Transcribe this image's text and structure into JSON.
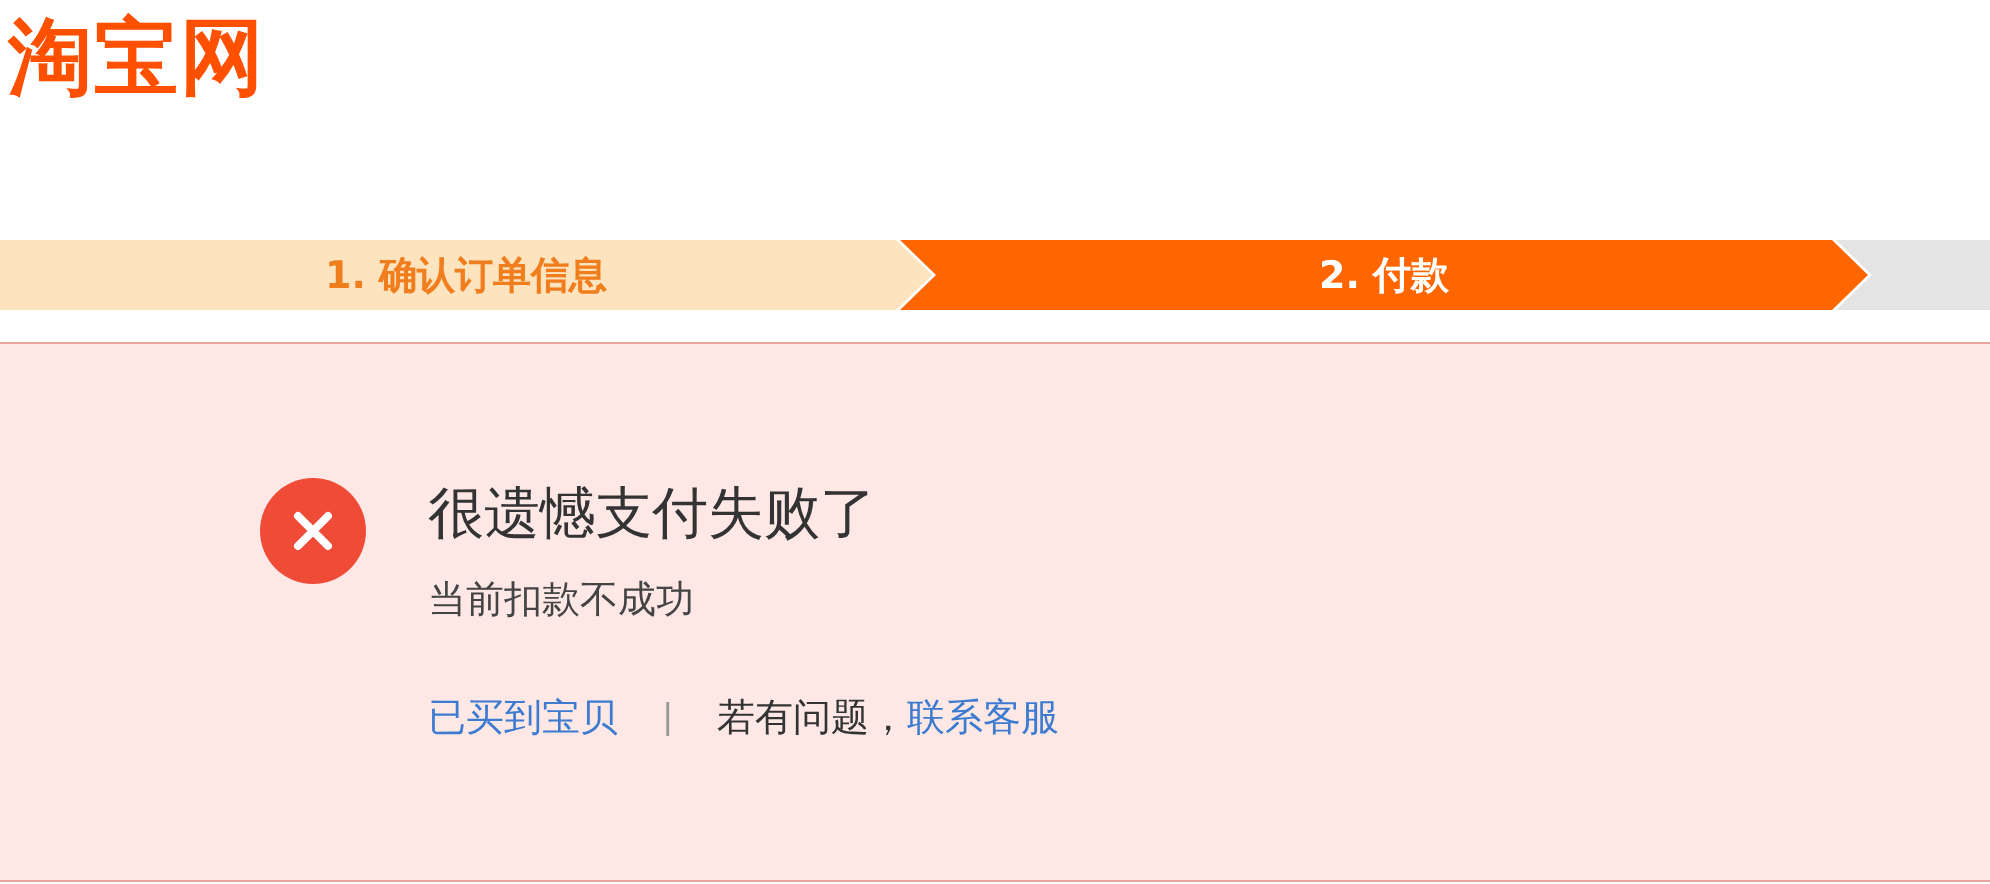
{
  "logo": "淘宝网",
  "steps": [
    {
      "label": "1. 确认订单信息",
      "selected": false
    },
    {
      "label": "2. 付款",
      "selected": true
    },
    {
      "selected": false
    }
  ],
  "result": {
    "kind": "error",
    "title": "很遗憾支付失败了",
    "message": "当前扣款不成功",
    "links": [
      {
        "kind": "link",
        "text": "已买到宝贝"
      },
      {
        "kind": "separator",
        "text": "|"
      },
      {
        "kind": "text",
        "text": "若有问题，"
      },
      {
        "kind": "link",
        "text": "联系客服"
      }
    ]
  }
}
